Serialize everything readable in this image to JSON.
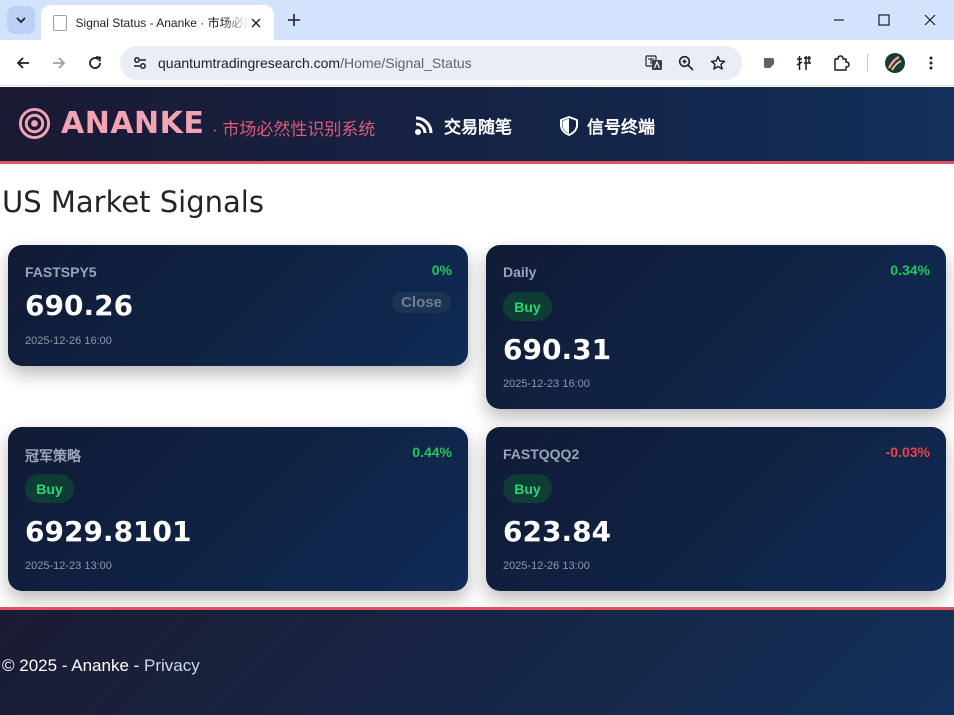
{
  "browser": {
    "tab_title": "Signal Status - Ananke · 市场必然性识别系统",
    "url_domain": "quantumtradingresearch.com",
    "url_path": "/Home/Signal_Status"
  },
  "header": {
    "brand": "ANANKE",
    "tagline": "· 市场必然性识别系统",
    "nav": [
      {
        "label": "交易随笔"
      },
      {
        "label": "信号终端"
      }
    ]
  },
  "page": {
    "title": "US Market Signals"
  },
  "cards": [
    {
      "name": "FASTSPY5",
      "change": "0%",
      "status": "Close",
      "price": "690.26",
      "time": "2025-12-26 16:00"
    },
    {
      "name": "Daily",
      "change": "0.34%",
      "status": "Buy",
      "price": "690.31",
      "time": "2025-12-23 16:00"
    },
    {
      "name": "冠军策略",
      "change": "0.44%",
      "status": "Buy",
      "price": "6929.8101",
      "time": "2025-12-23 13:00"
    },
    {
      "name": "FASTQQQ2",
      "change": "-0.03%",
      "status": "Buy",
      "price": "623.84",
      "time": "2025-12-26 13:00"
    }
  ],
  "footer": {
    "copyright": "© 2025 - Ananke - ",
    "privacy": "Privacy"
  },
  "colors": {
    "accent": "#e05260",
    "positive": "#22c55e",
    "negative": "#ef4444",
    "brand": "#f4a3b4"
  }
}
